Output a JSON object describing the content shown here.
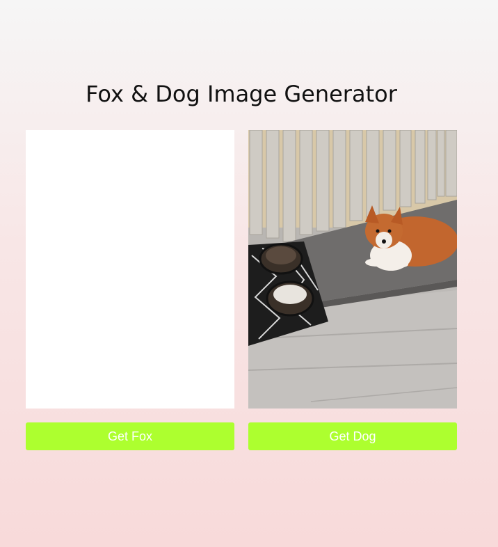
{
  "page": {
    "title": "Fox & Dog Image Generator"
  },
  "fox": {
    "button_label": "Get Fox"
  },
  "dog": {
    "button_label": "Get Dog"
  },
  "colors": {
    "button": "#adff2f",
    "title": "#111111",
    "fox_panel_bg": "#ffffff"
  }
}
